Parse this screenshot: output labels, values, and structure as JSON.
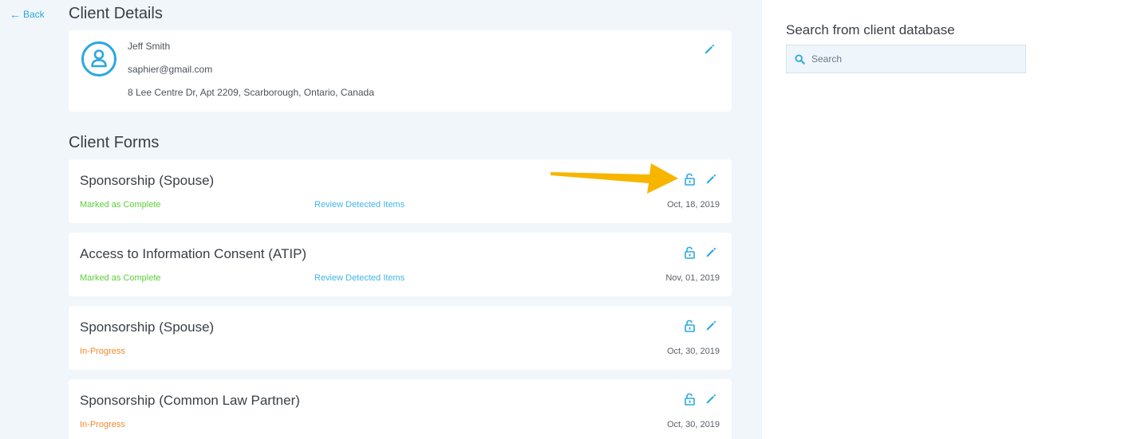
{
  "nav": {
    "back_label": "Back"
  },
  "page_title": "Client Details",
  "client": {
    "name": "Jeff Smith",
    "email": "saphier@gmail.com",
    "address": "8 Lee Centre Dr, Apt 2209, Scarborough, Ontario, Canada"
  },
  "forms_section_title": "Client Forms",
  "forms": [
    {
      "title": "Sponsorship (Spouse)",
      "status": "Marked as Complete",
      "status_type": "complete",
      "review_label": "Review Detected Items",
      "date": "Oct, 18, 2019"
    },
    {
      "title": "Access to Information Consent (ATIP)",
      "status": "Marked as Complete",
      "status_type": "complete",
      "review_label": "Review Detected Items",
      "date": "Nov, 01, 2019"
    },
    {
      "title": "Sponsorship (Spouse)",
      "status": "In-Progress",
      "status_type": "progress",
      "review_label": "",
      "date": "Oct, 30, 2019"
    },
    {
      "title": "Sponsorship (Common Law Partner)",
      "status": "In-Progress",
      "status_type": "progress",
      "review_label": "",
      "date": "Oct, 30, 2019"
    }
  ],
  "search": {
    "title": "Search from client database",
    "placeholder": "Search"
  },
  "icons": {
    "back": "arrow-left-icon",
    "avatar": "user-avatar-icon",
    "edit": "pencil-icon",
    "lock": "unlock-icon",
    "search": "search-icon"
  },
  "colors": {
    "accent": "#2aa8e0",
    "complete": "#5ccf3a",
    "in_progress": "#f08a2c",
    "annotation_arrow": "#f7b500",
    "pane_background": "#f1f6fa"
  }
}
